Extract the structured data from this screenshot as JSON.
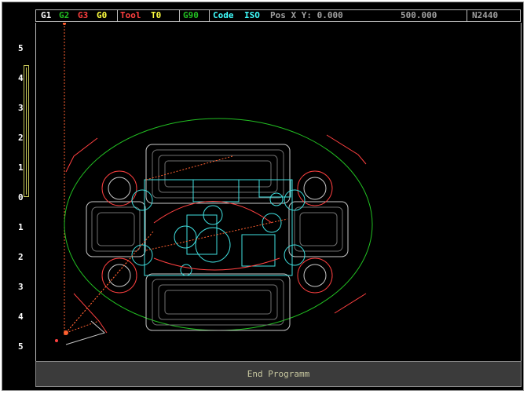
{
  "statusbar": {
    "g1": "G1",
    "g2": "G2",
    "g3": "G3",
    "g0": "G0",
    "tool_label": "Tool",
    "tool_value": "T0",
    "g90": "G90",
    "code_label": "Code",
    "code_value": "ISO",
    "pos_label": "Pos X Y: 0.000",
    "pos_y": "500.000",
    "line_number": "N2440"
  },
  "axis": {
    "ticks": [
      "5",
      "4",
      "3",
      "2",
      "1",
      "0",
      "1",
      "2",
      "3",
      "4",
      "5"
    ]
  },
  "footer": {
    "message": "End Programm"
  },
  "colors": {
    "g1": "#ffffff",
    "g2": "#22c022",
    "g3": "#ff4040",
    "g0": "#ffff40",
    "tool": "#ff4040",
    "g90": "#22c022",
    "code": "#40ffff",
    "pos": "#a0a0a0",
    "contour_outer": "#22c022",
    "contour_feed": "#ff4040",
    "contour_rapid": "#ff6030",
    "contour_pocket": "#c8c8c8",
    "contour_highlight": "#40e0e0"
  }
}
